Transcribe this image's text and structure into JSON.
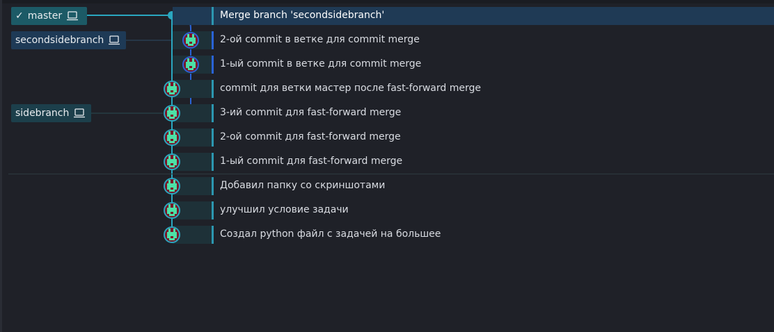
{
  "branches": {
    "master": {
      "label": "master",
      "current": true
    },
    "secondsidebranch": {
      "label": "secondsidebranch"
    },
    "sidebranch": {
      "label": "sidebranch"
    }
  },
  "commits": [
    {
      "message": "Merge branch 'secondsidebranch'",
      "selected": true
    },
    {
      "message": "2-ой commit в ветке для commit merge"
    },
    {
      "message": "1-ый commit в ветке для commit merge"
    },
    {
      "message": "commit для ветки мастер после fast-forward merge"
    },
    {
      "message": "3-ий commit для fast-forward merge"
    },
    {
      "message": "2-ой commit для fast-forward merge"
    },
    {
      "message": "1-ый commit для fast-forward merge"
    },
    {
      "message": "Добавил папку со скриншотами"
    },
    {
      "message": "улучшил условие задачи"
    },
    {
      "message": "Создал python файл с задачей на большее"
    }
  ],
  "colors": {
    "background": "#1f2128",
    "lane_teal": "#2aa7c0",
    "lane_blue": "#2a63d6",
    "selected_row": "#1f3a55"
  }
}
